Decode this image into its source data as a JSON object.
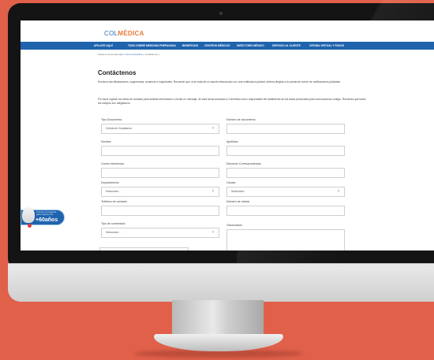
{
  "brand": {
    "name_left": "COL",
    "name_right": "MÉDICA"
  },
  "nav": {
    "items": [
      "AFILIATE AQUÍ",
      "TODO SOBRE MEDICINA PREPAGADA",
      "BENEFICIOS",
      "CENTROS MÉDICOS",
      "DIRECTORIO MÉDICO",
      "SERVICIO AL CLIENTE",
      "OFICINA VIRTUAL Y PAGOS"
    ]
  },
  "breadcrumb": {
    "prefix": "Usted se encuentra aquí:",
    "home": "Inicio Colmédica",
    "current": "» contáctenos »"
  },
  "page": {
    "title": "Contáctenos",
    "intro": "Envíenos las felicitaciones, sugerencias, reclamos e inquietudes. Recuerde que, si se trata de un asunto relacionado con una notificación judicial, deberá dirigirla a la cuenta de correo de notificaciones judiciales",
    "instructions": "Por favor ingrese los datos de contacto para solicitar información o enviar un mensaje, de esta forma autorizas a Colmédica como responsable del tratamiento de tus datos personales para comunicarnos contigo. Recuerda que todos los campos son obligatorios"
  },
  "form": {
    "tipo_documento": {
      "label": "Tipo Documento:",
      "value": "Cédula de Ciudadanía"
    },
    "numero_documento": {
      "label": "Número de documento:",
      "value": ""
    },
    "nombre": {
      "label": "Nombre",
      "value": ""
    },
    "apellidos": {
      "label": "Apellidos",
      "value": ""
    },
    "correo": {
      "label": "Correo electrónico",
      "value": ""
    },
    "direccion": {
      "label": "Dirección Correspondencia:",
      "value": ""
    },
    "departamento": {
      "label": "Departamento",
      "value": "Seleccione..."
    },
    "ciudad": {
      "label": "Ciudad",
      "value": "Seleccione..."
    },
    "telefono": {
      "label": "Teléfono de contacto",
      "value": ""
    },
    "celular": {
      "label": "Número de celular",
      "value": ""
    },
    "tipo_comentario": {
      "label": "Tipo de comentario",
      "value": "Seleccione..."
    },
    "observacion": {
      "label": "Observación",
      "value": ""
    }
  },
  "badge": {
    "line1": "Conoce el programa",
    "line2": "para mayores",
    "line3": "de",
    "big": "+60años"
  }
}
